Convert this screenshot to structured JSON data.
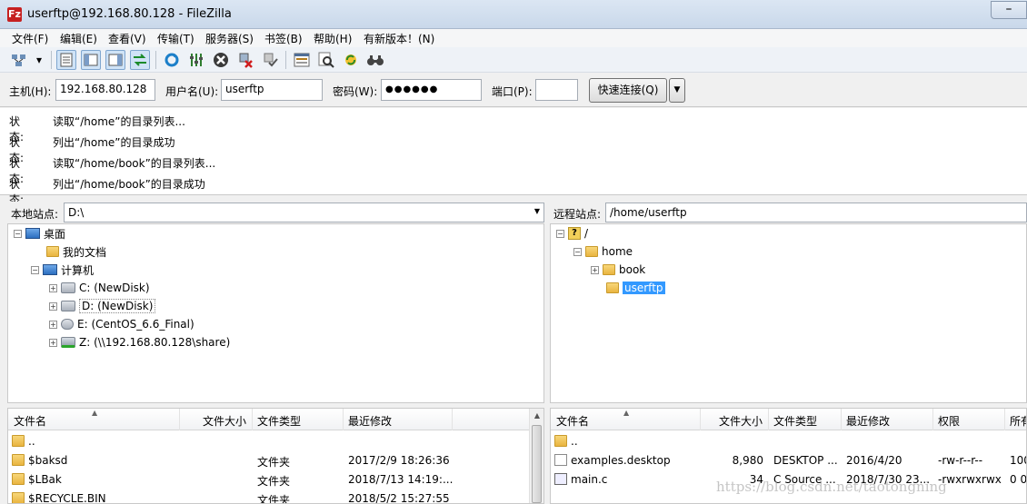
{
  "window": {
    "title": "userftp@192.168.80.128 - FileZilla",
    "app_icon_letter": "Fz"
  },
  "menu": [
    "文件(F)",
    "编辑(E)",
    "查看(V)",
    "传输(T)",
    "服务器(S)",
    "书签(B)",
    "帮助(H)",
    "有新版本！(N)"
  ],
  "quickconnect": {
    "host_label": "主机(H):",
    "host_value": "192.168.80.128",
    "user_label": "用户名(U):",
    "user_value": "userftp",
    "pass_label": "密码(W):",
    "pass_value": "●●●●●●",
    "port_label": "端口(P):",
    "port_value": "",
    "connect_label": "快速连接(Q)"
  },
  "log": [
    {
      "key": "状态:",
      "text": "读取“/home”的目录列表..."
    },
    {
      "key": "状态:",
      "text": "列出“/home”的目录成功"
    },
    {
      "key": "状态:",
      "text": "读取“/home/book”的目录列表..."
    },
    {
      "key": "状态:",
      "text": "列出“/home/book”的目录成功"
    }
  ],
  "local": {
    "site_label": "本地站点:",
    "path": "D:\\",
    "tree": [
      "桌面",
      "我的文档",
      "计算机",
      "C: (NewDisk)",
      "D: (NewDisk)",
      "E: (CentOS_6.6_Final)",
      "Z: (\\\\192.168.80.128\\share)"
    ],
    "columns": [
      "文件名",
      "文件大小",
      "文件类型",
      "最近修改"
    ],
    "files": [
      {
        "name": "..",
        "size": "",
        "type": "",
        "modified": ""
      },
      {
        "name": "$baksd",
        "size": "",
        "type": "文件夹",
        "modified": "2017/2/9 18:26:36"
      },
      {
        "name": "$LBak",
        "size": "",
        "type": "文件夹",
        "modified": "2018/7/13 14:19:..."
      },
      {
        "name": "$RECYCLE.BIN",
        "size": "",
        "type": "文件夹",
        "modified": "2018/5/2 15:27:55"
      }
    ]
  },
  "remote": {
    "site_label": "远程站点:",
    "path": "/home/userftp",
    "tree": [
      "/",
      "home",
      "book",
      "userftp"
    ],
    "columns": [
      "文件名",
      "文件大小",
      "文件类型",
      "最近修改",
      "权限",
      "所有"
    ],
    "files": [
      {
        "name": "..",
        "size": "",
        "type": "",
        "modified": "",
        "perm": "",
        "owner": ""
      },
      {
        "name": "examples.desktop",
        "size": "8,980",
        "type": "DESKTOP ...",
        "modified": "2016/4/20",
        "perm": "-rw-r--r--",
        "owner": "100"
      },
      {
        "name": "main.c",
        "size": "34",
        "type": "C Source ...",
        "modified": "2018/7/30 23...",
        "perm": "-rwxrwxrwx",
        "owner": "0 0"
      }
    ]
  },
  "watermark": "https://blog.csdn.net/taotongning"
}
